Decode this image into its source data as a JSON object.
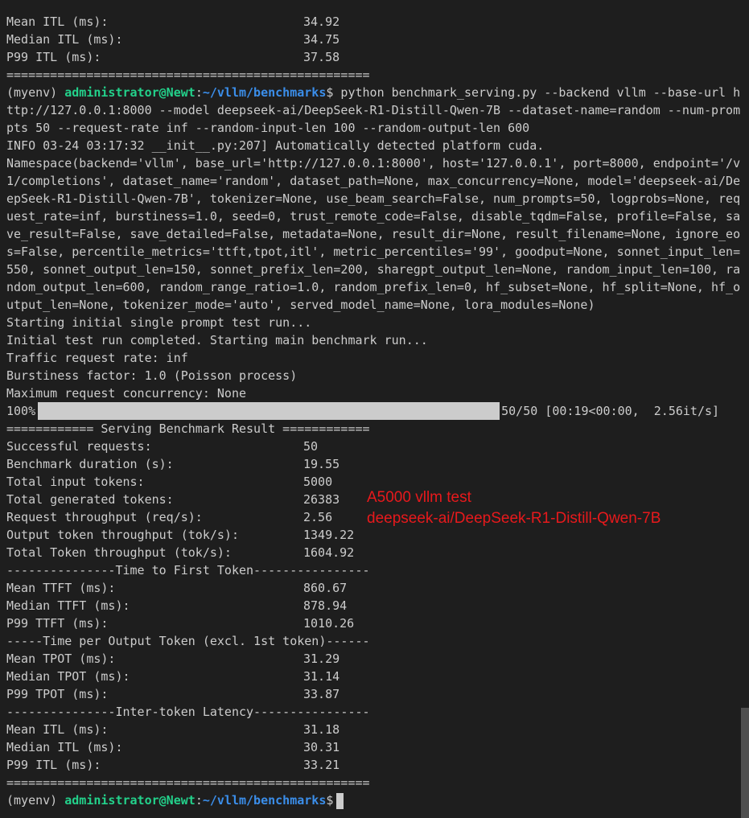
{
  "colors": {
    "background": "#1e1e1e",
    "text": "#cccccc",
    "prompt_user": "#23d18b",
    "prompt_path": "#3b8eea",
    "annotation": "#e8191c"
  },
  "header_metrics": [
    {
      "label": "Mean ITL (ms):",
      "value": "34.92"
    },
    {
      "label": "Median ITL (ms):",
      "value": "34.75"
    },
    {
      "label": "P99 ITL (ms):",
      "value": "37.58"
    }
  ],
  "separator": "==================================================",
  "prompt": {
    "env": "(myenv) ",
    "user_host": "administrator@Newt",
    "colon": ":",
    "path": "~/vllm/benchmarks",
    "symbol": "$"
  },
  "command_lines": [
    " python benchmark_serving.py --backend vllm --base-url h",
    "ttp://127.0.0.1:8000 --model deepseek-ai/DeepSeek-R1-Distill-Qwen-7B --dataset-name=random --num-prom",
    "pts 50 --request-rate inf --random-input-len 100 --random-output-len 600"
  ],
  "log_lines": [
    "INFO 03-24 03:17:32 __init__.py:207] Automatically detected platform cuda.",
    "Namespace(backend='vllm', base_url='http://127.0.0.1:8000', host='127.0.0.1', port=8000, endpoint='/v",
    "1/completions', dataset_name='random', dataset_path=None, max_concurrency=None, model='deepseek-ai/De",
    "epSeek-R1-Distill-Qwen-7B', tokenizer=None, use_beam_search=False, num_prompts=50, logprobs=None, req",
    "uest_rate=inf, burstiness=1.0, seed=0, trust_remote_code=False, disable_tqdm=False, profile=False, sa",
    "ve_result=False, save_detailed=False, metadata=None, result_dir=None, result_filename=None, ignore_eo",
    "s=False, percentile_metrics='ttft,tpot,itl', metric_percentiles='99', goodput=None, sonnet_input_len=",
    "550, sonnet_output_len=150, sonnet_prefix_len=200, sharegpt_output_len=None, random_input_len=100, ra",
    "ndom_output_len=600, random_range_ratio=1.0, random_prefix_len=0, hf_subset=None, hf_split=None, hf_o",
    "utput_len=None, tokenizer_mode='auto', served_model_name=None, lora_modules=None)",
    "Starting initial single prompt test run...",
    "Initial test run completed. Starting main benchmark run...",
    "Traffic request rate: inf",
    "Burstiness factor: 1.0 (Poisson process)",
    "Maximum request concurrency: None"
  ],
  "progress": {
    "percent_label": "100%",
    "fraction": 1.0,
    "count": "50/50",
    "timing": "[00:19<00:00,  2.56it/s]"
  },
  "result_title": "============ Serving Benchmark Result ============",
  "summary_metrics": [
    {
      "label": "Successful requests:",
      "value": "50"
    },
    {
      "label": "Benchmark duration (s):",
      "value": "19.55"
    },
    {
      "label": "Total input tokens:",
      "value": "5000"
    },
    {
      "label": "Total generated tokens:",
      "value": "26383"
    },
    {
      "label": "Request throughput (req/s):",
      "value": "2.56"
    },
    {
      "label": "Output token throughput (tok/s):",
      "value": "1349.22"
    },
    {
      "label": "Total Token throughput (tok/s):",
      "value": "1604.92"
    }
  ],
  "ttft_header": "---------------Time to First Token----------------",
  "ttft_metrics": [
    {
      "label": "Mean TTFT (ms):",
      "value": "860.67"
    },
    {
      "label": "Median TTFT (ms):",
      "value": "878.94"
    },
    {
      "label": "P99 TTFT (ms):",
      "value": "1010.26"
    }
  ],
  "tpot_header": "-----Time per Output Token (excl. 1st token)------",
  "tpot_metrics": [
    {
      "label": "Mean TPOT (ms):",
      "value": "31.29"
    },
    {
      "label": "Median TPOT (ms):",
      "value": "31.14"
    },
    {
      "label": "P99 TPOT (ms):",
      "value": "33.87"
    }
  ],
  "itl_header": "---------------Inter-token Latency----------------",
  "itl_metrics": [
    {
      "label": "Mean ITL (ms):",
      "value": "31.18"
    },
    {
      "label": "Median ITL (ms):",
      "value": "30.31"
    },
    {
      "label": "P99 ITL (ms):",
      "value": "33.21"
    }
  ],
  "annotation": {
    "line1": "A5000 vllm test",
    "line2": "deepseek-ai/DeepSeek-R1-Distill-Qwen-7B"
  }
}
